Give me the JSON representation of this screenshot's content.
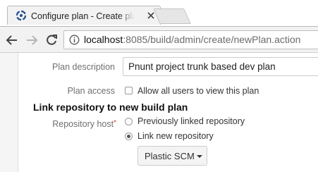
{
  "browser": {
    "tab": {
      "title": "Configure plan - Create plan",
      "favicon": "bamboo-logo-icon",
      "close_icon": "close-icon"
    },
    "nav": {
      "back_icon": "arrow-left-icon",
      "forward_icon": "arrow-right-icon",
      "reload_icon": "reload-icon"
    },
    "address_bar": {
      "info_icon": "info-icon",
      "host": "localhost",
      "rest": ":8085/build/admin/create/newPlan.action"
    }
  },
  "form": {
    "plan_description": {
      "label": "Plan description",
      "value": "Pnunt project trunk based dev plan"
    },
    "plan_access": {
      "label": "Plan access",
      "checkbox_label": "Allow all users to view this plan",
      "checked": false
    },
    "section_title": "Link repository to new build plan",
    "repository_host": {
      "label": "Repository host",
      "required_marker": "*",
      "options": [
        {
          "label": "Previously linked repository",
          "selected": false
        },
        {
          "label": "Link new repository",
          "selected": true
        }
      ],
      "select": {
        "value": "Plastic SCM"
      }
    }
  },
  "colors": {
    "required": "#d04437",
    "toolbar_bg": "#f2f2f2",
    "label_text": "#707070"
  }
}
